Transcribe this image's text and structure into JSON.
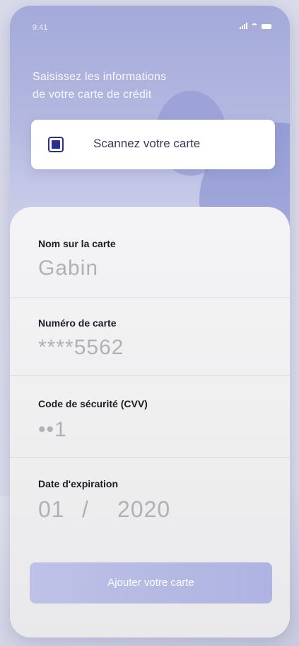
{
  "status_bar": {
    "time": "9:41"
  },
  "header": {
    "title_line1": "Saisissez les informations",
    "title_line2": "de votre carte de crédit"
  },
  "scan": {
    "label": "Scannez votre carte"
  },
  "form": {
    "name": {
      "label": "Nom sur la carte",
      "value": "Gabin"
    },
    "number": {
      "label": "Numéro de carte",
      "value": "****5562"
    },
    "cvv": {
      "label": "Code de sécurité (CVV)",
      "value": "••1"
    },
    "expiry": {
      "label": "Date d'expiration",
      "month": "01",
      "separator": "/",
      "year": "2020"
    }
  },
  "actions": {
    "add_card_label": "Ajouter votre carte"
  },
  "colors": {
    "accent": "#2c2f8e",
    "header_gradient_top": "#a4aad9",
    "button": "#a8aee0"
  },
  "icons": {
    "scan": "card-scan-icon",
    "signal": "signal-icon",
    "wifi": "wifi-icon",
    "battery": "battery-icon"
  }
}
